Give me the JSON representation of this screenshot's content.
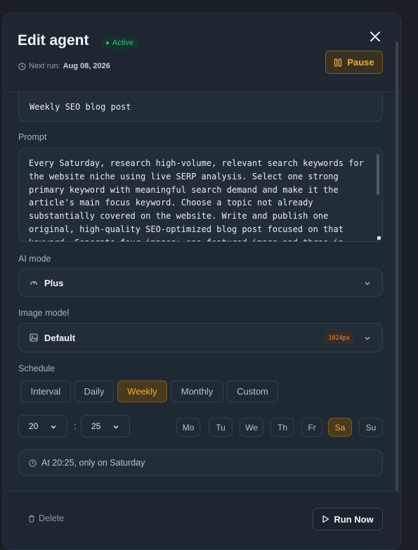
{
  "header": {
    "title": "Edit agent",
    "status_badge": "Active",
    "next_run_label": "Next run:",
    "next_run_value": "Aug 08, 2026",
    "pause_label": "Pause"
  },
  "name_field": {
    "value": "Weekly SEO blog post"
  },
  "prompt": {
    "label": "Prompt",
    "value": "Every Saturday, research high-volume, relevant search keywords for the website niche using live SERP analysis. Select one strong primary keyword with meaningful search demand and make it the article's main focus keyword. Choose a topic not already substantially covered on the website. Write and publish one original, high-quality SEO-optimized blog post focused on that keyword. Generate four images: one featured image and three in-text images. Add relevant internal links to"
  },
  "ai_mode": {
    "label": "AI mode",
    "value": "Plus",
    "icon": "gauge-icon"
  },
  "image_model": {
    "label": "Image model",
    "value": "Default",
    "size_badge": "1024px",
    "icon": "image-icon"
  },
  "schedule": {
    "label": "Schedule",
    "tabs": [
      "Interval",
      "Daily",
      "Weekly",
      "Monthly",
      "Custom"
    ],
    "active_tab": "Weekly",
    "hour": "20",
    "minute": "25",
    "separator": ":",
    "days": [
      "Mo",
      "Tu",
      "We",
      "Th",
      "Fr",
      "Sa",
      "Su"
    ],
    "active_day": "Sa",
    "summary": "At 20:25, only on Saturday"
  },
  "footer": {
    "delete_label": "Delete",
    "run_now_label": "Run Now"
  },
  "colors": {
    "accent": "#f0a93a",
    "active_green": "#35c27f",
    "panel": "#1f2933"
  }
}
